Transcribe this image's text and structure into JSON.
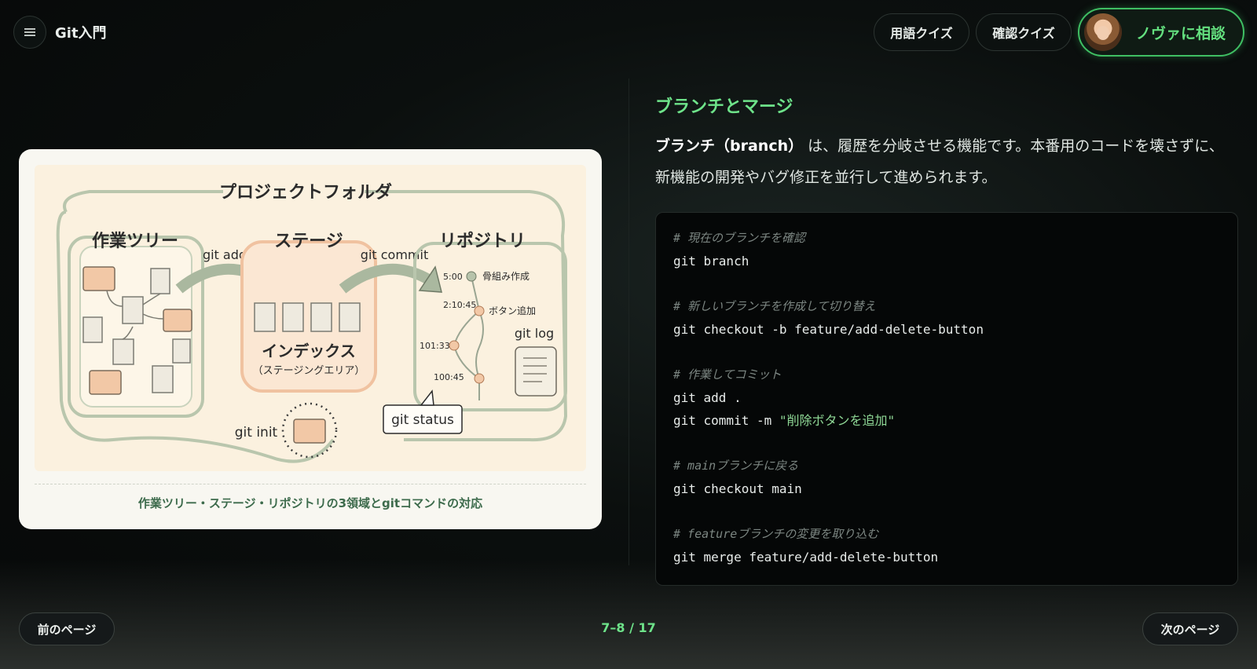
{
  "app": {
    "title": "Git入門"
  },
  "header": {
    "vocab_quiz_label": "用語クイズ",
    "check_quiz_label": "確認クイズ",
    "consult_label": "ノヴァに相談"
  },
  "figure": {
    "labels": {
      "project_folder": "プロジェクトフォルダ",
      "worktree": "作業ツリー",
      "stage": "ステージ",
      "repository": "リポジトリ",
      "git_add": "git add",
      "git_commit": "git commit",
      "index": "インデックス",
      "staging_area": "（ステージングエリア）",
      "git_log": "git log",
      "git_status": "git status",
      "git_init": "git init",
      "commits": [
        {
          "time": "5:00",
          "label": "骨組み作成"
        },
        {
          "time": "2:10:45",
          "label": "ボタン追加"
        },
        {
          "time": "101:33",
          "label": ""
        },
        {
          "time": "100:45",
          "label": ""
        }
      ]
    },
    "caption": "作業ツリー・ステージ・リポジトリの3領域とgitコマンドの対応"
  },
  "section": {
    "title": "ブランチとマージ",
    "term": "ブランチ（branch）",
    "body": "は、履歴を分岐させる機能です。本番用のコードを壊さずに、新機能の開発やバグ修正を並行して進められます。"
  },
  "code": {
    "c1": "# 現在のブランチを確認",
    "l1": "git branch",
    "c2": "# 新しいブランチを作成して切り替え",
    "l2": "git checkout -b feature/add-delete-button",
    "c3": "# 作業してコミット",
    "l3": "git add .",
    "l4_cmd": "git commit -m ",
    "l4_str": "\"削除ボタンを追加\"",
    "c4": "# mainブランチに戻る",
    "l5": "git checkout main",
    "c5": "# featureブランチの変更を取り込む",
    "l6": "git merge feature/add-delete-button"
  },
  "footer": {
    "prev_label": "前のページ",
    "next_label": "次のページ",
    "page": "7–8 / 17"
  },
  "colors": {
    "accent": "#6ee38a",
    "nova_border": "#3fbf63"
  },
  "icons": {
    "menu": "hamburger-icon",
    "avatar": "nova-avatar"
  }
}
